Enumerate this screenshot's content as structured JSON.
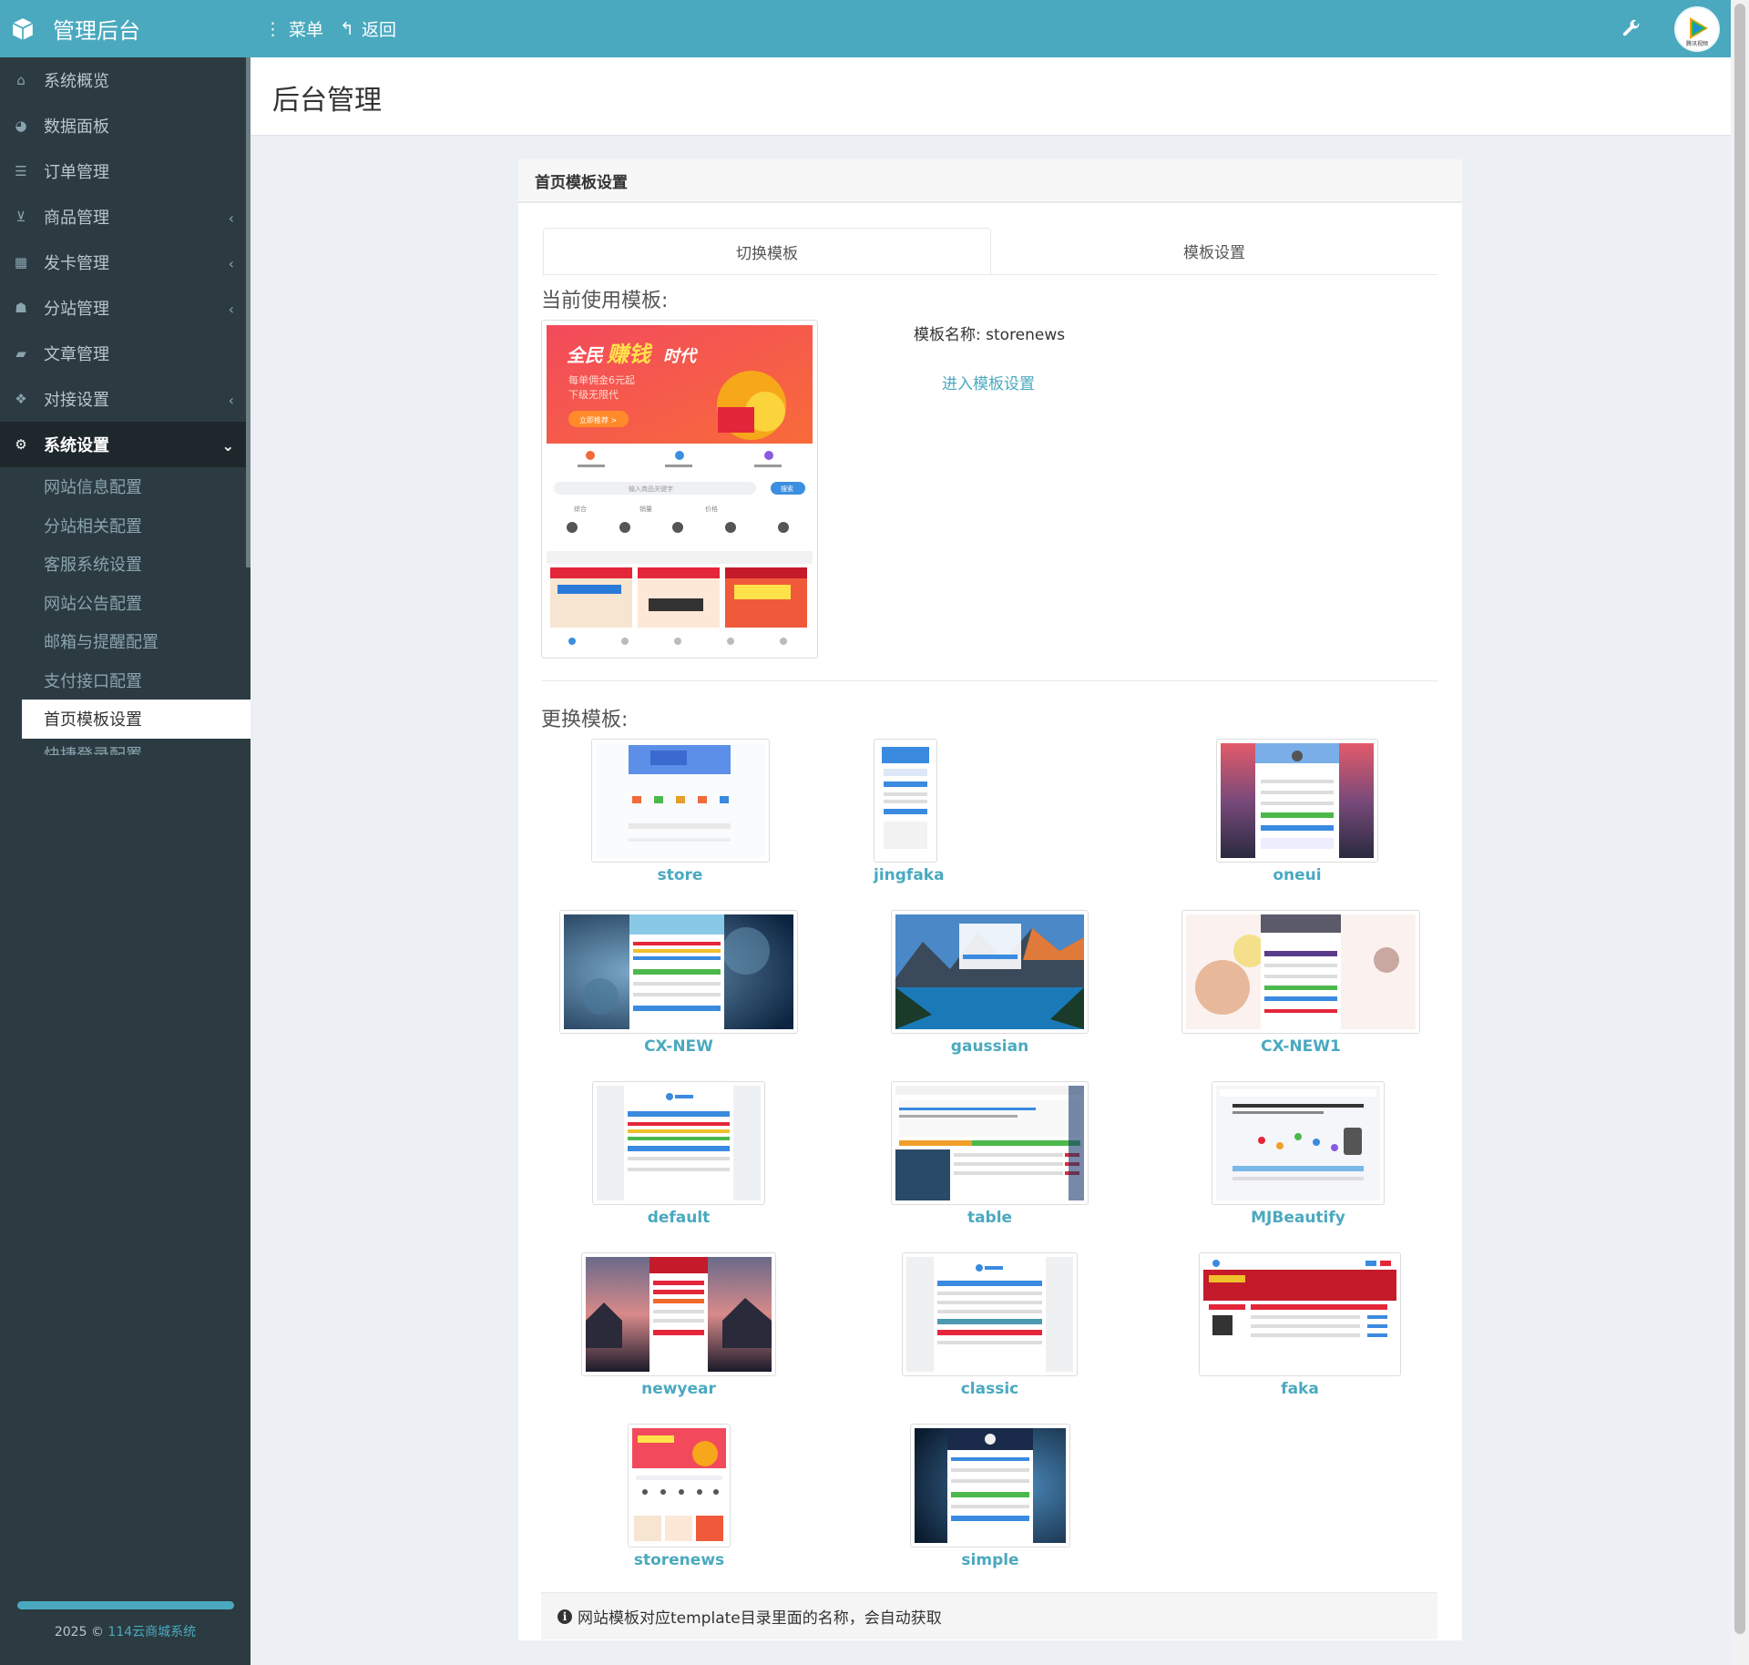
{
  "header": {
    "brand": "管理后台",
    "menu_label": "菜单",
    "back_label": "返回",
    "avatar_text": "腾讯视频"
  },
  "sidebar": {
    "items": [
      {
        "label": "系统概览",
        "icon": "home-icon"
      },
      {
        "label": "数据面板",
        "icon": "dashboard-icon"
      },
      {
        "label": "订单管理",
        "icon": "list-icon"
      },
      {
        "label": "商品管理",
        "icon": "cart-icon",
        "chevron": "left"
      },
      {
        "label": "发卡管理",
        "icon": "grid-icon",
        "chevron": "left"
      },
      {
        "label": "分站管理",
        "icon": "sitemap-icon",
        "chevron": "left"
      },
      {
        "label": "文章管理",
        "icon": "book-icon"
      },
      {
        "label": "对接设置",
        "icon": "cubes-icon",
        "chevron": "left"
      },
      {
        "label": "系统设置",
        "icon": "gear-icon",
        "chevron": "down",
        "active": true
      }
    ],
    "subitems": [
      "网站信息配置",
      "分站相关配置",
      "客服系统设置",
      "网站公告配置",
      "邮箱与提醒配置",
      "支付接口配置",
      "首页模板设置",
      "快捷登录配置"
    ],
    "footer": {
      "year": "2025 ©",
      "link": "114云商城系统"
    }
  },
  "content": {
    "page_title": "后台管理",
    "panel_title": "首页模板设置",
    "tabs": [
      "切换模板",
      "模板设置"
    ],
    "current_title": "当前使用模板:",
    "template_name_label": "模板名称:",
    "template_name": "storenews",
    "enter_settings": "进入模板设置",
    "change_title": "更换模板:",
    "templates": [
      "store",
      "jingfaka",
      "oneui",
      "CX-NEW",
      "gaussian",
      "CX-NEW1",
      "default",
      "table",
      "MJBeautify",
      "newyear",
      "classic",
      "faka",
      "storenews",
      "simple"
    ],
    "tip": "网站模板对应template目录里面的名称，会自动获取"
  },
  "preview": {
    "banner_line1": "全民",
    "banner_line1b": "赚钱",
    "banner_line1c": "时代",
    "banner_line2": "每单佣金6元起",
    "banner_line3": "下级无限代",
    "banner_btn": "立即推荐 >",
    "search_placeholder": "输入商品关键字",
    "search_btn": "搜索",
    "sort": [
      "综合",
      "销量",
      "价格"
    ]
  },
  "colors": {
    "accent": "#4aa9bf",
    "sidebar_bg": "#2c3b41",
    "sidebar_active": "#1e282c"
  }
}
